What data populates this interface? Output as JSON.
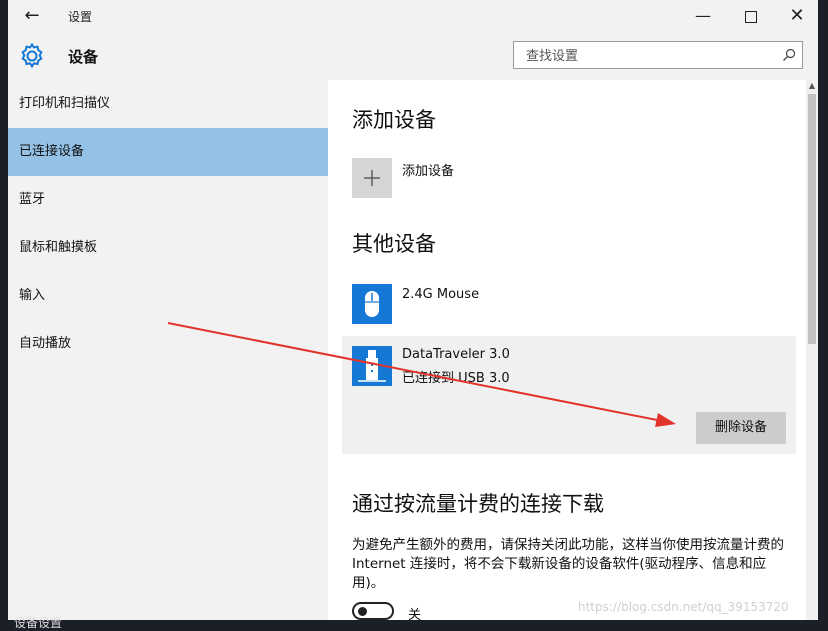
{
  "window": {
    "title": "设置",
    "back_icon": "back-arrow-icon",
    "controls": {
      "minimize": "—",
      "maximize": "□",
      "close": "✕"
    }
  },
  "header": {
    "title": "设备",
    "icon": "gear-icon",
    "search_placeholder": "查找设置"
  },
  "sidebar": {
    "selected_index": 1,
    "items": [
      {
        "label": "打印机和扫描仪"
      },
      {
        "label": "已连接设备"
      },
      {
        "label": "蓝牙"
      },
      {
        "label": "鼠标和触摸板"
      },
      {
        "label": "输入"
      },
      {
        "label": "自动播放"
      }
    ]
  },
  "main": {
    "add_section": {
      "heading": "添加设备",
      "add_label": "添加设备"
    },
    "other_section": {
      "heading": "其他设备",
      "devices": [
        {
          "name": "2.4G Mouse",
          "icon": "mouse-icon"
        },
        {
          "name": "DataTraveler 3.0",
          "status": "已连接到 USB 3.0",
          "icon": "usb-drive-icon"
        }
      ],
      "remove_button": "删除设备"
    },
    "metered_section": {
      "heading": "通过按流量计费的连接下载",
      "description": "为避免产生额外的费用，请保持关闭此功能，这样当你使用按流量计费的 Internet 连接时，将不会下载新设备的设备软件(驱动程序、信息和应用)。",
      "toggle_state_label": "关",
      "toggle_on": false
    }
  },
  "overlay": {
    "watermark": "https://blog.csdn.net/qq_39153720",
    "taskbar_text": "设备设置",
    "arrow_color": "#e2332b"
  },
  "colors": {
    "accent": "#1578d4",
    "selected_nav": "#94c2e6"
  }
}
